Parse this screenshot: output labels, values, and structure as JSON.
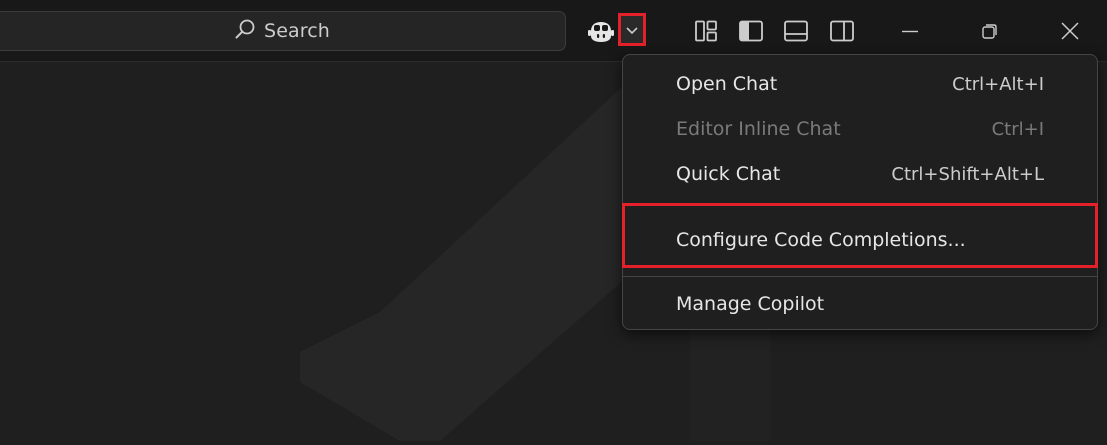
{
  "title_bar": {
    "search_label": "Search",
    "icons": [
      "search-icon",
      "copilot-icon",
      "chevron-down-icon",
      "customize-layout-icon",
      "toggle-primary-sidebar-icon",
      "toggle-panel-icon",
      "toggle-secondary-sidebar-icon",
      "minimize-icon",
      "restore-icon",
      "close-icon"
    ]
  },
  "menu": {
    "items": [
      {
        "label": "Open Chat",
        "shortcut": "Ctrl+Alt+I",
        "enabled": true
      },
      {
        "label": "Editor Inline Chat",
        "shortcut": "Ctrl+I",
        "enabled": false
      },
      {
        "label": "Quick Chat",
        "shortcut": "Ctrl+Shift+Alt+L",
        "enabled": true
      },
      {
        "label": "Configure Code Completions...",
        "shortcut": "",
        "enabled": true,
        "highlighted": true
      },
      {
        "label": "Manage Copilot",
        "shortcut": "",
        "enabled": true
      }
    ]
  },
  "colors": {
    "background": "#1f1f1f",
    "titlebar": "#181818",
    "highlight_red": "#e4212b",
    "disabled_text": "#7a7a7a"
  }
}
